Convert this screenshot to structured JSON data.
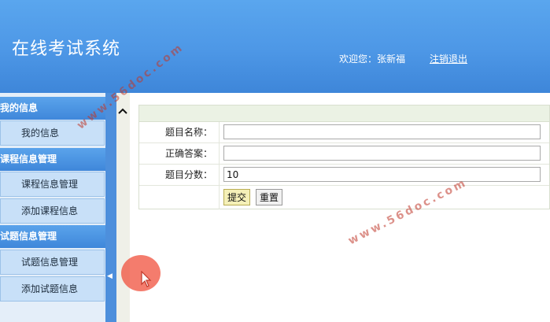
{
  "header": {
    "title": "在线考试系统",
    "welcome": "欢迎您：张新福",
    "logout": "注销退出"
  },
  "watermark": "www.56doc.com",
  "sidebar": {
    "groups": [
      {
        "title": "我的信息",
        "items": [
          "我的信息"
        ]
      },
      {
        "title": "课程信息管理",
        "items": [
          "课程信息管理",
          "添加课程信息"
        ]
      },
      {
        "title": "试题信息管理",
        "items": [
          "试题信息管理",
          "添加试题信息"
        ]
      }
    ]
  },
  "form": {
    "fields": [
      {
        "label": "题目名称：",
        "value": ""
      },
      {
        "label": "正确答案：",
        "value": ""
      },
      {
        "label": "题目分数：",
        "value": "10"
      }
    ],
    "submit_label": "提交",
    "reset_label": "重置"
  },
  "icons": {
    "scroll_up": "chevron-up-icon",
    "collapse": "triangle-left-icon",
    "cursor": "mouse-pointer-icon"
  },
  "colors": {
    "header": "#4d97e6",
    "menu_header": "#4a93e2",
    "menu_item": "#c8e0f8",
    "submit_button": "#f5f0b8",
    "cursor_halo": "#f0503c"
  }
}
